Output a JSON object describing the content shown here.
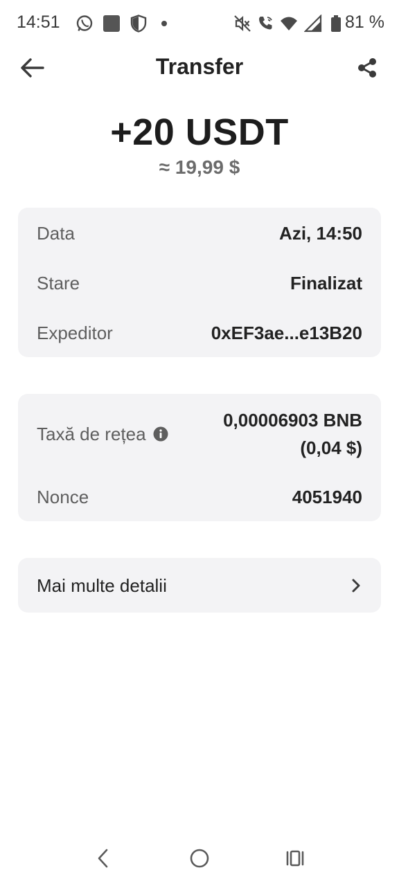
{
  "status_bar": {
    "time": "14:51",
    "battery": "81 %",
    "icons": [
      "whatsapp-icon",
      "app-square-icon",
      "shield-icon",
      "dot-icon",
      "mute-icon",
      "wifi-calling-icon",
      "wifi-icon",
      "signal-icon",
      "battery-icon"
    ]
  },
  "header": {
    "title": "Transfer",
    "back_icon": "arrow-left-icon",
    "share_icon": "share-icon"
  },
  "amount": {
    "value": "+20 USDT",
    "fiat": "≈ 19,99 $"
  },
  "details": {
    "rows": [
      {
        "label": "Data",
        "value": "Azi, 14:50"
      },
      {
        "label": "Stare",
        "value": "Finalizat"
      },
      {
        "label": "Expeditor",
        "value": "0xEF3ae...e13B20"
      }
    ]
  },
  "network": {
    "fee_label": "Taxă de rețea",
    "fee_value_line1": "0,00006903 BNB",
    "fee_value_line2": "(0,04 $)",
    "nonce_label": "Nonce",
    "nonce_value": "4051940"
  },
  "more": {
    "label": "Mai multe detalii",
    "icon": "chevron-right-icon"
  },
  "navbar": {
    "icons": [
      "nav-back-icon",
      "nav-home-icon",
      "nav-recents-icon"
    ]
  },
  "colors": {
    "card_bg": "#f3f3f5",
    "text_primary": "#222222",
    "text_secondary": "#5e5e5e"
  }
}
